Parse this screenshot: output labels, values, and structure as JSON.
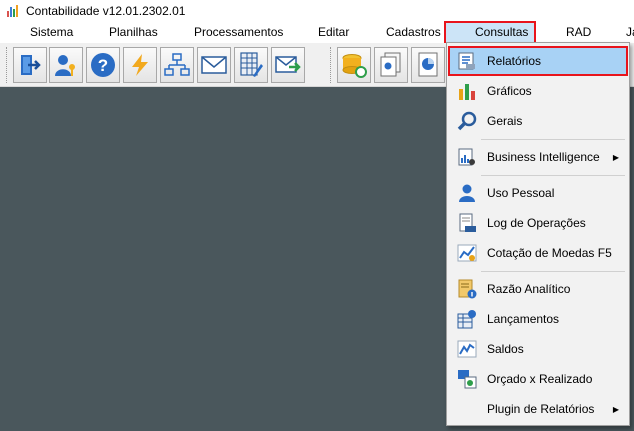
{
  "window": {
    "title": "Contabilidade v12.01.2302.01"
  },
  "menubar": {
    "items": [
      "Sistema",
      "Planilhas",
      "Processamentos",
      "Editar",
      "Cadastros",
      "Consultas",
      "RAD",
      "Ja"
    ],
    "active": "Consultas"
  },
  "toolbar": {
    "buttons": [
      "exit-icon",
      "users-key-icon",
      "help-icon",
      "lightning-icon",
      "flowchart-icon",
      "envelope-icon",
      "spreadsheet-pen-icon",
      "mail-send-icon",
      "coins-refresh-icon",
      "pages-icon",
      "pie-chart-icon"
    ]
  },
  "consultas_menu": {
    "items": [
      {
        "label": "Relatórios",
        "icon": "report-icon",
        "highlighted": true
      },
      {
        "label": "Gráficos",
        "icon": "bar-chart-icon"
      },
      {
        "label": "Gerais",
        "icon": "magnifier-icon"
      },
      {
        "label": "Business Intelligence",
        "icon": "business-intelligence-icon",
        "submenu": true
      },
      {
        "label": "Uso Pessoal",
        "icon": "user-icon"
      },
      {
        "label": "Log de Operações",
        "icon": "log-document-icon"
      },
      {
        "label": "Cotação de Moedas F5",
        "icon": "currency-chart-icon"
      },
      {
        "label": "Razão Analítico",
        "icon": "ledger-info-icon"
      },
      {
        "label": "Lançamentos",
        "icon": "entries-icon"
      },
      {
        "label": "Saldos",
        "icon": "balance-chart-icon"
      },
      {
        "label": "Orçado x Realizado",
        "icon": "budget-vs-actual-icon"
      },
      {
        "label": "Plugin de Relatórios",
        "icon": "",
        "submenu": true
      }
    ]
  },
  "colors": {
    "accent_outline": "#e8141c",
    "highlight": "#a8d2f5",
    "workspace": "#4a575c"
  }
}
